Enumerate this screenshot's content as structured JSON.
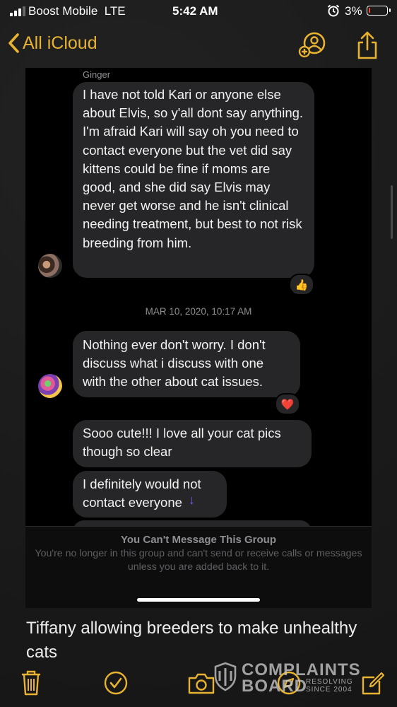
{
  "status_bar": {
    "carrier": "Boost Mobile",
    "network": "LTE",
    "time": "5:42 AM",
    "battery_percent": "3%",
    "battery_level": 0.03,
    "icons": [
      "signal-bars-icon",
      "alarm-clock-icon",
      "battery-icon"
    ]
  },
  "nav": {
    "back_label": "All iCloud",
    "accent_color": "#e8b331",
    "icons": [
      "chevron-left-icon",
      "add-person-icon",
      "share-icon"
    ]
  },
  "screenshot": {
    "sender_name": "Ginger",
    "messages": [
      {
        "text": "I have not told Kari or anyone else about Elvis, so y'all dont say anything. I'm afraid Kari will say oh you need to contact everyone but the vet did say kittens could be fine if moms are good, and she did say Elvis may never get worse and he isn't clinical needing treatment, but best to not risk breeding from him.",
        "reaction": "👍"
      },
      {
        "text": "Nothing ever don't worry. I don't discuss what i discuss with one with the other about cat issues.",
        "reaction": "❤️"
      },
      {
        "text": "Sooo cute!!! I love all your cat pics though so clear"
      },
      {
        "text": "I definitely would not contact everyone"
      }
    ],
    "timestamp": "MAR 10, 2020, 10:17 AM",
    "banner_title": "You Can't Message This Group",
    "banner_text": "You're no longer in this group and can't send or receive calls or messages unless you are added back to it."
  },
  "note": {
    "caption": "Tiffany allowing breeders to make unhealthy cats"
  },
  "toolbar": {
    "icons": [
      "trash-icon",
      "checkmark-circle-icon",
      "camera-icon",
      "compass-icon",
      "compose-icon"
    ]
  },
  "watermark": {
    "line1": "COMPLAINTS",
    "line2": "BOARD",
    "sub1": "RESOLVING",
    "sub2": "SINCE 2004"
  }
}
